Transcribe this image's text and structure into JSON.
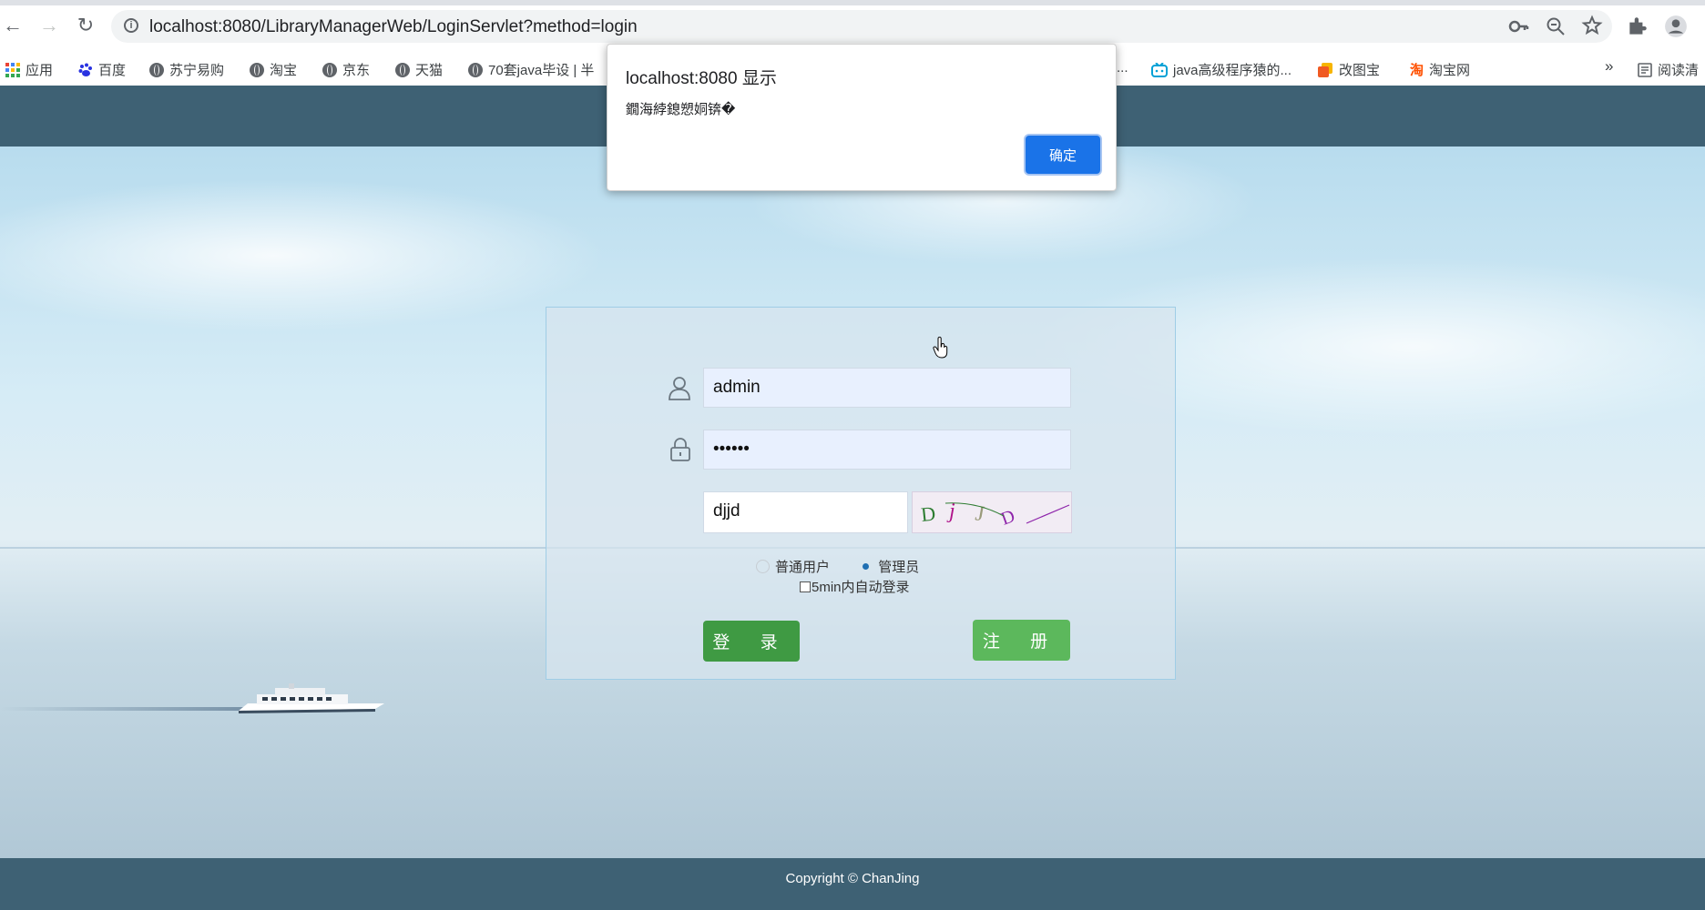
{
  "browser": {
    "url": "localhost:8080/LibraryManagerWeb/LoginServlet?method=login",
    "bookmarks": [
      {
        "label": "应用",
        "icon": "apps-grid-icon"
      },
      {
        "label": "百度",
        "icon": "baidu-paw-icon"
      },
      {
        "label": "苏宁易购",
        "icon": "globe-icon"
      },
      {
        "label": "淘宝",
        "icon": "globe-icon"
      },
      {
        "label": "京东",
        "icon": "globe-icon"
      },
      {
        "label": "天猫",
        "icon": "globe-icon"
      },
      {
        "label": "70套java毕设 | 半",
        "icon": "globe-icon"
      },
      {
        "label": "...",
        "icon": ""
      },
      {
        "label": "java高级程序猿的...",
        "icon": "bilibili-icon"
      },
      {
        "label": "改图宝",
        "icon": "gaitubao-icon"
      },
      {
        "label": "淘宝网",
        "icon": "taobao-icon"
      }
    ],
    "overflow_label": "»",
    "reading_list_label": "阅读清",
    "colors": {
      "accent": "#1a73e8"
    }
  },
  "dialog": {
    "title": "localhost:8080 显示",
    "message": "鐗海綍鎴愬姛锛�",
    "ok_label": "确定"
  },
  "login": {
    "username": "admin",
    "password": "••••••",
    "captcha_input": "djjd",
    "captcha_text": "D j J D",
    "roles": [
      "普通用户",
      "管理员"
    ],
    "selected_role": "管理员",
    "autologin_label": "5min内自动登录",
    "login_label": "登 录",
    "register_label": "注 册"
  },
  "footer": {
    "copyright": "Copyright © ChanJing"
  },
  "colors": {
    "header_bg": "#3e6174",
    "login_button": "#3f9a43",
    "register_button": "#5cb85c"
  }
}
